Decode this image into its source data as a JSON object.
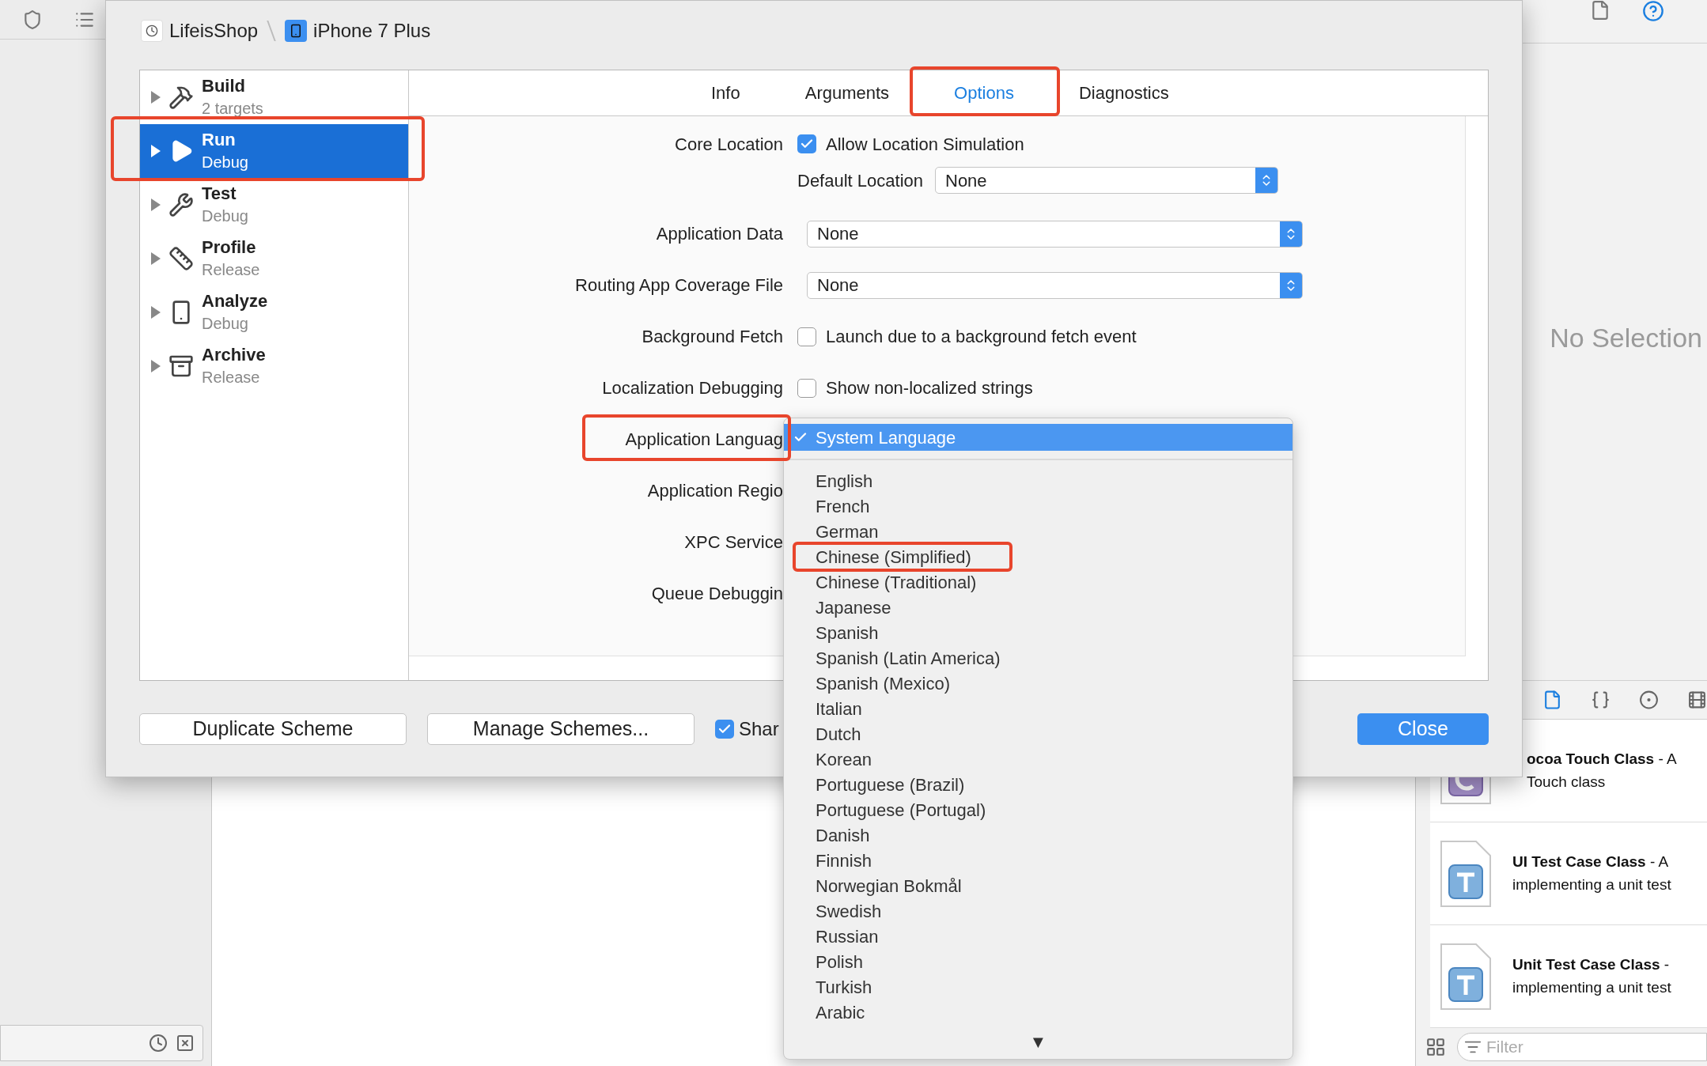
{
  "inspector": {
    "empty_label": "No Selection"
  },
  "library": {
    "templates": [
      {
        "kind": "cocoa",
        "title": "**ocoa Touch Class** - A",
        "description": "Touch class"
      },
      {
        "kind": "test",
        "title": "**UI Test Case Class** - A",
        "description": "implementing a unit test"
      },
      {
        "kind": "test",
        "title": "**Unit Test Case Class** -",
        "description": "implementing a unit test"
      }
    ],
    "filter_placeholder": "Filter"
  },
  "scheme_editor": {
    "breadcrumb": [
      {
        "kind": "app",
        "label": "LifeisShop"
      },
      {
        "kind": "device",
        "label": "iPhone 7 Plus"
      }
    ],
    "actions": [
      {
        "kind": "build",
        "name": "Build",
        "subtitle": "2 targets",
        "selected": false
      },
      {
        "kind": "run",
        "name": "Run",
        "subtitle": "Debug",
        "selected": true
      },
      {
        "kind": "test",
        "name": "Test",
        "subtitle": "Debug",
        "selected": false
      },
      {
        "kind": "profile",
        "name": "Profile",
        "subtitle": "Release",
        "selected": false
      },
      {
        "kind": "analyze",
        "name": "Analyze",
        "subtitle": "Debug",
        "selected": false
      },
      {
        "kind": "archive",
        "name": "Archive",
        "subtitle": "Release",
        "selected": false
      }
    ],
    "tabs": [
      {
        "label": "Info",
        "selected": false
      },
      {
        "label": "Arguments",
        "selected": false
      },
      {
        "label": "Options",
        "selected": true
      },
      {
        "label": "Diagnostics",
        "selected": false
      }
    ],
    "options": [
      {
        "kind": "checkbox",
        "label": "Core Location",
        "text": "Allow Location Simulation",
        "checked": true
      },
      {
        "kind": "sub_popup",
        "label": "Default Location",
        "value": "None"
      },
      {
        "kind": "popup",
        "label": "Application Data",
        "value": "None"
      },
      {
        "kind": "popup",
        "label": "Routing App Coverage File",
        "value": "None"
      },
      {
        "kind": "checkbox",
        "label": "Background Fetch",
        "text": "Launch due to a background fetch event",
        "checked": false
      },
      {
        "kind": "checkbox",
        "label": "Localization Debugging",
        "text": "Show non-localized strings",
        "checked": false
      },
      {
        "kind": "covered",
        "label": "Application Languag"
      },
      {
        "kind": "covered",
        "label": "Application Regio"
      },
      {
        "kind": "covered",
        "label": "XPC Service"
      },
      {
        "kind": "covered",
        "label": "Queue Debuggin"
      }
    ],
    "buttons": [
      {
        "kind": "plain",
        "label": "Duplicate Scheme"
      },
      {
        "kind": "plain",
        "label": "Manage Schemes..."
      },
      {
        "kind": "checkbox",
        "label": "Shar",
        "checked": true
      },
      {
        "kind": "primary",
        "label": "Close"
      }
    ]
  },
  "language_menu": {
    "items": [
      {
        "label": "System Language",
        "selected": true
      },
      {
        "label": "English",
        "selected": false
      },
      {
        "label": "French",
        "selected": false
      },
      {
        "label": "German",
        "selected": false
      },
      {
        "label": "Chinese (Simplified)",
        "selected": false
      },
      {
        "label": "Chinese (Traditional)",
        "selected": false
      },
      {
        "label": "Japanese",
        "selected": false
      },
      {
        "label": "Spanish",
        "selected": false
      },
      {
        "label": "Spanish (Latin America)",
        "selected": false
      },
      {
        "label": "Spanish (Mexico)",
        "selected": false
      },
      {
        "label": "Italian",
        "selected": false
      },
      {
        "label": "Dutch",
        "selected": false
      },
      {
        "label": "Korean",
        "selected": false
      },
      {
        "label": "Portuguese (Brazil)",
        "selected": false
      },
      {
        "label": "Portuguese (Portugal)",
        "selected": false
      },
      {
        "label": "Danish",
        "selected": false
      },
      {
        "label": "Finnish",
        "selected": false
      },
      {
        "label": "Norwegian Bokmål",
        "selected": false
      },
      {
        "label": "Swedish",
        "selected": false
      },
      {
        "label": "Russian",
        "selected": false
      },
      {
        "label": "Polish",
        "selected": false
      },
      {
        "label": "Turkish",
        "selected": false
      },
      {
        "label": "Arabic",
        "selected": false
      }
    ],
    "scroll_arrow": "▼"
  }
}
